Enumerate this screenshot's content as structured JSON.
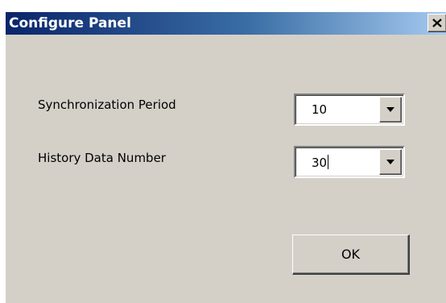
{
  "window": {
    "title": "Configure Panel",
    "close_icon": "close-icon",
    "titlebar_colors": [
      "#0a246a",
      "#a6caf0"
    ],
    "background_color": "#d4d0c8"
  },
  "form": {
    "sync_period": {
      "label": "Synchronization Period",
      "value": "10",
      "dropdown_icon": "dropdown-arrow-icon"
    },
    "history_number": {
      "label": "History Data Number",
      "value": "30",
      "dropdown_icon": "dropdown-arrow-icon"
    }
  },
  "buttons": {
    "ok_label": "OK"
  }
}
